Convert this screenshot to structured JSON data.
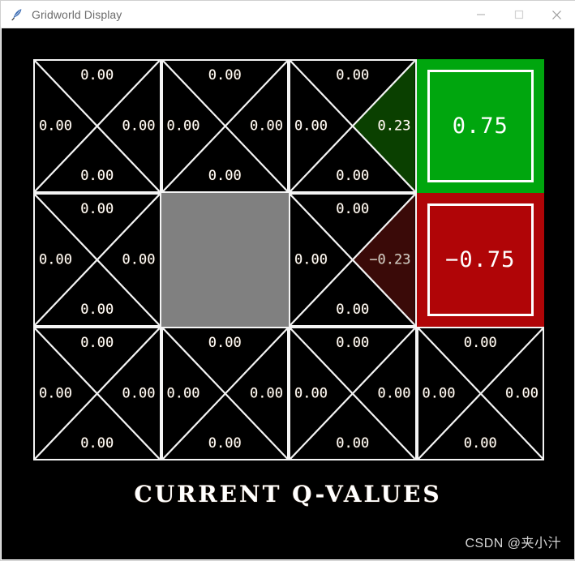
{
  "window": {
    "title": "Gridworld Display",
    "icon": "feather-icon",
    "controls": {
      "minimize": "minimize-icon",
      "maximize": "maximize-icon",
      "close": "close-icon"
    }
  },
  "caption": "CURRENT  Q-VALUES",
  "watermark": "CSDN @夹小汁",
  "colors": {
    "background": "#000000",
    "grid_line": "#f4f4f4",
    "wall": "#808080",
    "terminal_good": "#00a60e",
    "terminal_bad": "#b00507",
    "tint_good": "#0a4000",
    "tint_bad": "#3a0a08",
    "value_text": "#ffffff"
  },
  "grid": {
    "rows": 3,
    "cols": 4,
    "cells": [
      {
        "id": "cell-r0c0",
        "row": 0,
        "col": 0,
        "type": "q",
        "north": "0.00",
        "south": "0.00",
        "west": "0.00",
        "east": "0.00",
        "best": "none"
      },
      {
        "id": "cell-r0c1",
        "row": 0,
        "col": 1,
        "type": "q",
        "north": "0.00",
        "south": "0.00",
        "west": "0.00",
        "east": "0.00",
        "best": "none"
      },
      {
        "id": "cell-r0c2",
        "row": 0,
        "col": 2,
        "type": "q",
        "north": "0.00",
        "south": "0.00",
        "west": "0.00",
        "east": "0.23",
        "best": "east",
        "best_tint": "good"
      },
      {
        "id": "cell-r0c3",
        "row": 0,
        "col": 3,
        "type": "terminal",
        "value": "0.75",
        "terminal_kind": "good"
      },
      {
        "id": "cell-r1c0",
        "row": 1,
        "col": 0,
        "type": "q",
        "north": "0.00",
        "south": "0.00",
        "west": "0.00",
        "east": "0.00",
        "best": "none"
      },
      {
        "id": "cell-r1c1",
        "row": 1,
        "col": 1,
        "type": "wall"
      },
      {
        "id": "cell-r1c2",
        "row": 1,
        "col": 2,
        "type": "q",
        "north": "0.00",
        "south": "0.00",
        "west": "0.00",
        "east": "−0.23",
        "best": "east",
        "best_tint": "bad"
      },
      {
        "id": "cell-r1c3",
        "row": 1,
        "col": 3,
        "type": "terminal",
        "value": "−0.75",
        "terminal_kind": "bad"
      },
      {
        "id": "cell-r2c0",
        "row": 2,
        "col": 0,
        "type": "q",
        "north": "0.00",
        "south": "0.00",
        "west": "0.00",
        "east": "0.00",
        "best": "none"
      },
      {
        "id": "cell-r2c1",
        "row": 2,
        "col": 1,
        "type": "q",
        "north": "0.00",
        "south": "0.00",
        "west": "0.00",
        "east": "0.00",
        "best": "none"
      },
      {
        "id": "cell-r2c2",
        "row": 2,
        "col": 2,
        "type": "q",
        "north": "0.00",
        "south": "0.00",
        "west": "0.00",
        "east": "0.00",
        "best": "none"
      },
      {
        "id": "cell-r2c3",
        "row": 2,
        "col": 3,
        "type": "q",
        "north": "0.00",
        "south": "0.00",
        "west": "0.00",
        "east": "0.00",
        "best": "none"
      }
    ]
  }
}
